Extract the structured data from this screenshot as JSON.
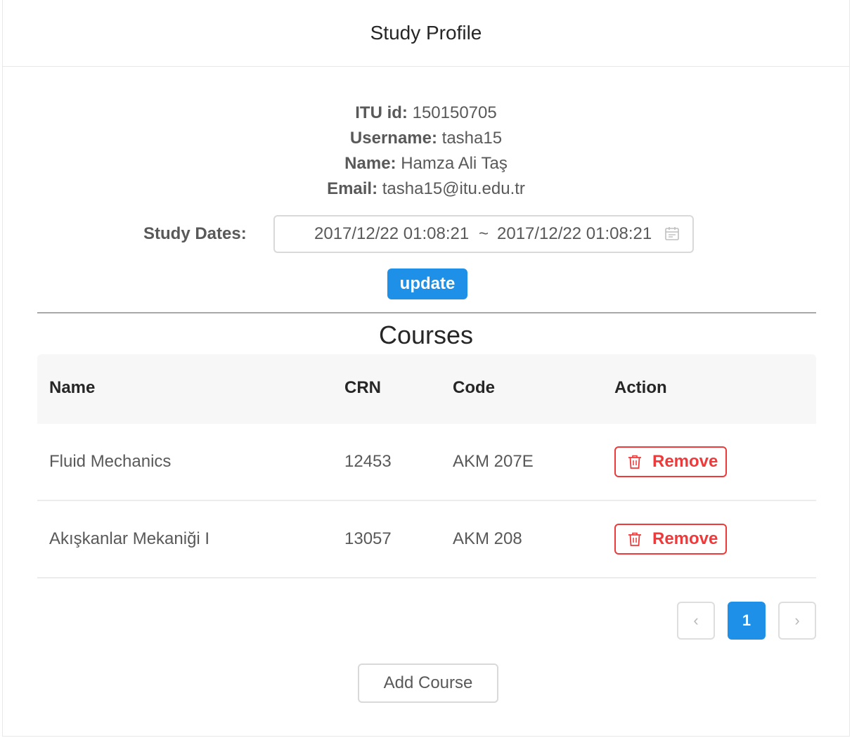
{
  "header": {
    "title": "Study Profile"
  },
  "profile": {
    "itu_id_label": "ITU id:",
    "itu_id": "150150705",
    "username_label": "Username:",
    "username": "tasha15",
    "name_label": "Name:",
    "name": "Hamza Ali Taş",
    "email_label": "Email:",
    "email": "tasha15@itu.edu.tr"
  },
  "study_dates": {
    "label": "Study Dates:",
    "start": "2017/12/22 01:08:21",
    "separator": "~",
    "end": "2017/12/22 01:08:21",
    "icon": "calendar-icon"
  },
  "update_label": "update",
  "courses": {
    "title": "Courses",
    "columns": [
      "Name",
      "CRN",
      "Code",
      "Action"
    ],
    "rows": [
      {
        "name": "Fluid Mechanics",
        "crn": "12453",
        "code": "AKM 207E",
        "action": "Remove"
      },
      {
        "name": "Akışkanlar Mekaniği I",
        "crn": "13057",
        "code": "AKM 208",
        "action": "Remove"
      }
    ]
  },
  "pagination": {
    "prev": "‹",
    "current": "1",
    "next": "›"
  },
  "add_course_label": "Add Course",
  "colors": {
    "primary": "#1e90e8",
    "danger": "#ee3a3a"
  }
}
